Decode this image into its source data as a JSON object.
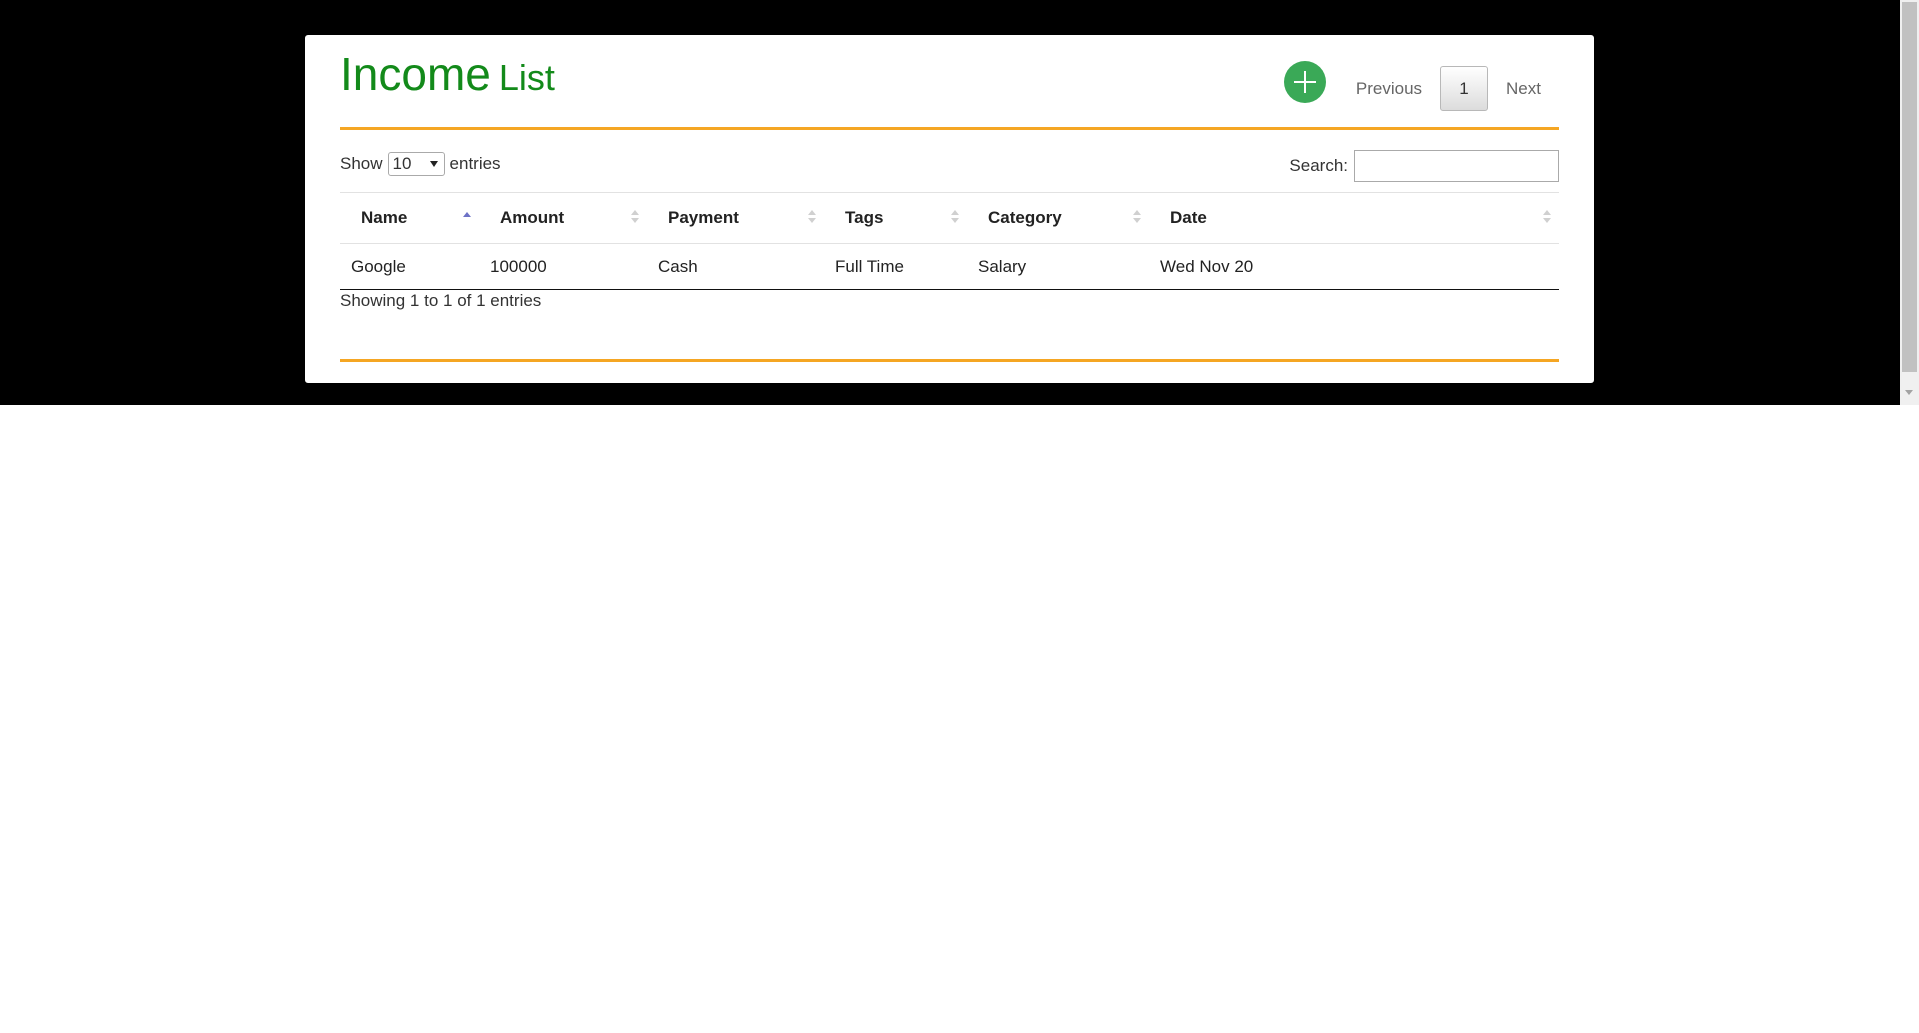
{
  "header": {
    "title_main": "Income",
    "title_sub": "List"
  },
  "controls": {
    "show_label": "Show",
    "entries_value": "10",
    "entries_label": "entries",
    "search_label": "Search:",
    "search_value": ""
  },
  "table": {
    "columns": [
      "Name",
      "Amount",
      "Payment",
      "Tags",
      "Category",
      "Date"
    ],
    "rows": [
      [
        "Google",
        "100000",
        "Cash",
        "Full Time",
        "Salary",
        "Wed Nov 20"
      ]
    ]
  },
  "footer": {
    "info": "Showing 1 to 1 of 1 entries",
    "previous": "Previous",
    "current_page": "1",
    "next": "Next"
  },
  "colors": {
    "title": "#138a1a",
    "accent_rule": "#f5a623",
    "add_button": "#3aa957"
  },
  "icons": {
    "add": "plus-circle-icon",
    "sort": "sort-arrows-icon"
  }
}
